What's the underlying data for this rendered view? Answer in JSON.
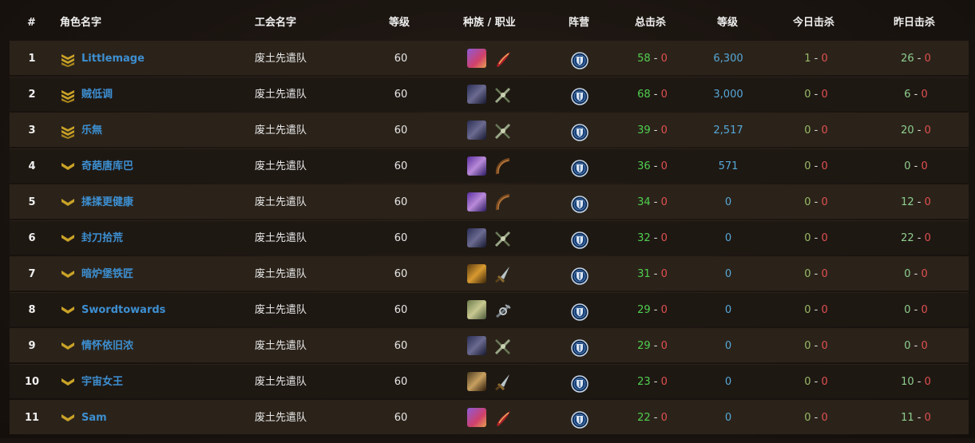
{
  "header": {
    "rank": "#",
    "name": "角色名字",
    "guild": "工会名字",
    "level": "等级",
    "race_class": "种族 / 职业",
    "faction": "阵营",
    "total_kills": "总击杀",
    "honor_level": "等级",
    "today_kills": "今日击杀",
    "yesterday_kills": "昨日击杀"
  },
  "separator": " - ",
  "rows": [
    {
      "rank": "1",
      "name": "Littlemage",
      "guild": "废土先遣队",
      "level": "60",
      "race_icon": "gnome-female-icon",
      "class_icon": "mage-icon",
      "faction_icon": "alliance-icon",
      "kills_a": "58",
      "kills_b": "0",
      "score": "6,300",
      "today_a": "1",
      "today_b": "0",
      "yest_a": "26",
      "yest_b": "0",
      "rank_icon": "triple-chevron-icon"
    },
    {
      "rank": "2",
      "name": "贼低调",
      "guild": "废土先遣队",
      "level": "60",
      "race_icon": "human-male-icon",
      "class_icon": "rogue-icon",
      "faction_icon": "alliance-icon",
      "kills_a": "68",
      "kills_b": "0",
      "score": "3,000",
      "today_a": "0",
      "today_b": "0",
      "yest_a": "6",
      "yest_b": "0",
      "rank_icon": "triple-chevron-icon"
    },
    {
      "rank": "3",
      "name": "乐無",
      "guild": "废土先遣队",
      "level": "60",
      "race_icon": "human-male-icon",
      "class_icon": "rogue-icon",
      "faction_icon": "alliance-icon",
      "kills_a": "39",
      "kills_b": "0",
      "score": "2,517",
      "today_a": "0",
      "today_b": "0",
      "yest_a": "20",
      "yest_b": "0",
      "rank_icon": "triple-chevron-icon"
    },
    {
      "rank": "4",
      "name": "奇葩唐库巴",
      "guild": "废土先遣队",
      "level": "60",
      "race_icon": "nightelf-female-icon",
      "class_icon": "hunter-icon",
      "faction_icon": "alliance-icon",
      "kills_a": "36",
      "kills_b": "0",
      "score": "571",
      "today_a": "0",
      "today_b": "0",
      "yest_a": "0",
      "yest_b": "0",
      "rank_icon": "single-chevron-icon"
    },
    {
      "rank": "5",
      "name": "揉揉更健康",
      "guild": "废土先遣队",
      "level": "60",
      "race_icon": "nightelf-female-icon",
      "class_icon": "hunter-icon",
      "faction_icon": "alliance-icon",
      "kills_a": "34",
      "kills_b": "0",
      "score": "0",
      "today_a": "0",
      "today_b": "0",
      "yest_a": "12",
      "yest_b": "0",
      "rank_icon": "single-chevron-icon"
    },
    {
      "rank": "6",
      "name": "封刀拾荒",
      "guild": "废土先遣队",
      "level": "60",
      "race_icon": "human-male-icon",
      "class_icon": "rogue-icon",
      "faction_icon": "alliance-icon",
      "kills_a": "32",
      "kills_b": "0",
      "score": "0",
      "today_a": "0",
      "today_b": "0",
      "yest_a": "22",
      "yest_b": "0",
      "rank_icon": "single-chevron-icon"
    },
    {
      "rank": "7",
      "name": "暗炉堡铁匠",
      "guild": "废土先遣队",
      "level": "60",
      "race_icon": "dwarf-male-icon",
      "class_icon": "warrior-icon",
      "faction_icon": "alliance-icon",
      "kills_a": "31",
      "kills_b": "0",
      "score": "0",
      "today_a": "0",
      "today_b": "0",
      "yest_a": "0",
      "yest_b": "0",
      "rank_icon": "single-chevron-icon"
    },
    {
      "rank": "8",
      "name": "Swordtowards",
      "guild": "废土先遣队",
      "level": "60",
      "race_icon": "gnome-male-icon",
      "class_icon": "warlock-icon",
      "faction_icon": "alliance-icon",
      "kills_a": "29",
      "kills_b": "0",
      "score": "0",
      "today_a": "0",
      "today_b": "0",
      "yest_a": "0",
      "yest_b": "0",
      "rank_icon": "single-chevron-icon"
    },
    {
      "rank": "9",
      "name": "情怀依旧浓",
      "guild": "废土先遣队",
      "level": "60",
      "race_icon": "human-male-icon",
      "class_icon": "rogue-icon",
      "faction_icon": "alliance-icon",
      "kills_a": "29",
      "kills_b": "0",
      "score": "0",
      "today_a": "0",
      "today_b": "0",
      "yest_a": "0",
      "yest_b": "0",
      "rank_icon": "single-chevron-icon"
    },
    {
      "rank": "10",
      "name": "宇宙女王",
      "guild": "废土先遣队",
      "level": "60",
      "race_icon": "dwarf-female-icon",
      "class_icon": "warrior-icon",
      "faction_icon": "alliance-icon",
      "kills_a": "23",
      "kills_b": "0",
      "score": "0",
      "today_a": "0",
      "today_b": "0",
      "yest_a": "10",
      "yest_b": "0",
      "rank_icon": "single-chevron-icon"
    },
    {
      "rank": "11",
      "name": "Sam",
      "guild": "废土先遣队",
      "level": "60",
      "race_icon": "gnome-female-icon",
      "class_icon": "mage-icon",
      "faction_icon": "alliance-icon",
      "kills_a": "22",
      "kills_b": "0",
      "score": "0",
      "today_a": "0",
      "today_b": "0",
      "yest_a": "11",
      "yest_b": "0",
      "rank_icon": "single-chevron-icon"
    }
  ],
  "colors": {
    "name": "#3d8fd1",
    "kills_positive": "#4fcf4f",
    "kills_negative": "#e05050",
    "score": "#56a8d8",
    "rank_chevron": "#c9a227"
  }
}
